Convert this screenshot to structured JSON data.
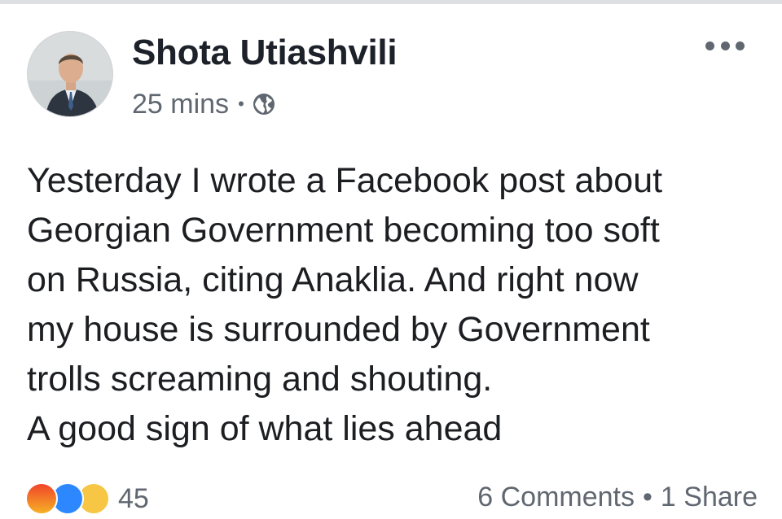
{
  "post": {
    "author": "Shota Utiashvili",
    "timestamp": "25 mins",
    "separator": "•",
    "audience_icon": "globe-icon",
    "more_icon": "more-options-icon",
    "text": "Yesterday I wrote a Facebook post about\nGeorgian Government becoming too soft\non Russia, citing Anaklia. And right now\nmy house is surrounded by Government\ntrolls screaming and shouting.\nA good sign of what lies ahead"
  },
  "footer": {
    "reactions": [
      "angry-icon",
      "like-icon",
      "haha-icon"
    ],
    "reaction_count": "45",
    "comments": "6 Comments",
    "separator": "•",
    "shares": "1 Share"
  },
  "colors": {
    "like": "#2d88ff",
    "angry": "#f0452a",
    "haha": "#f7c645",
    "meta_text": "#606770"
  }
}
